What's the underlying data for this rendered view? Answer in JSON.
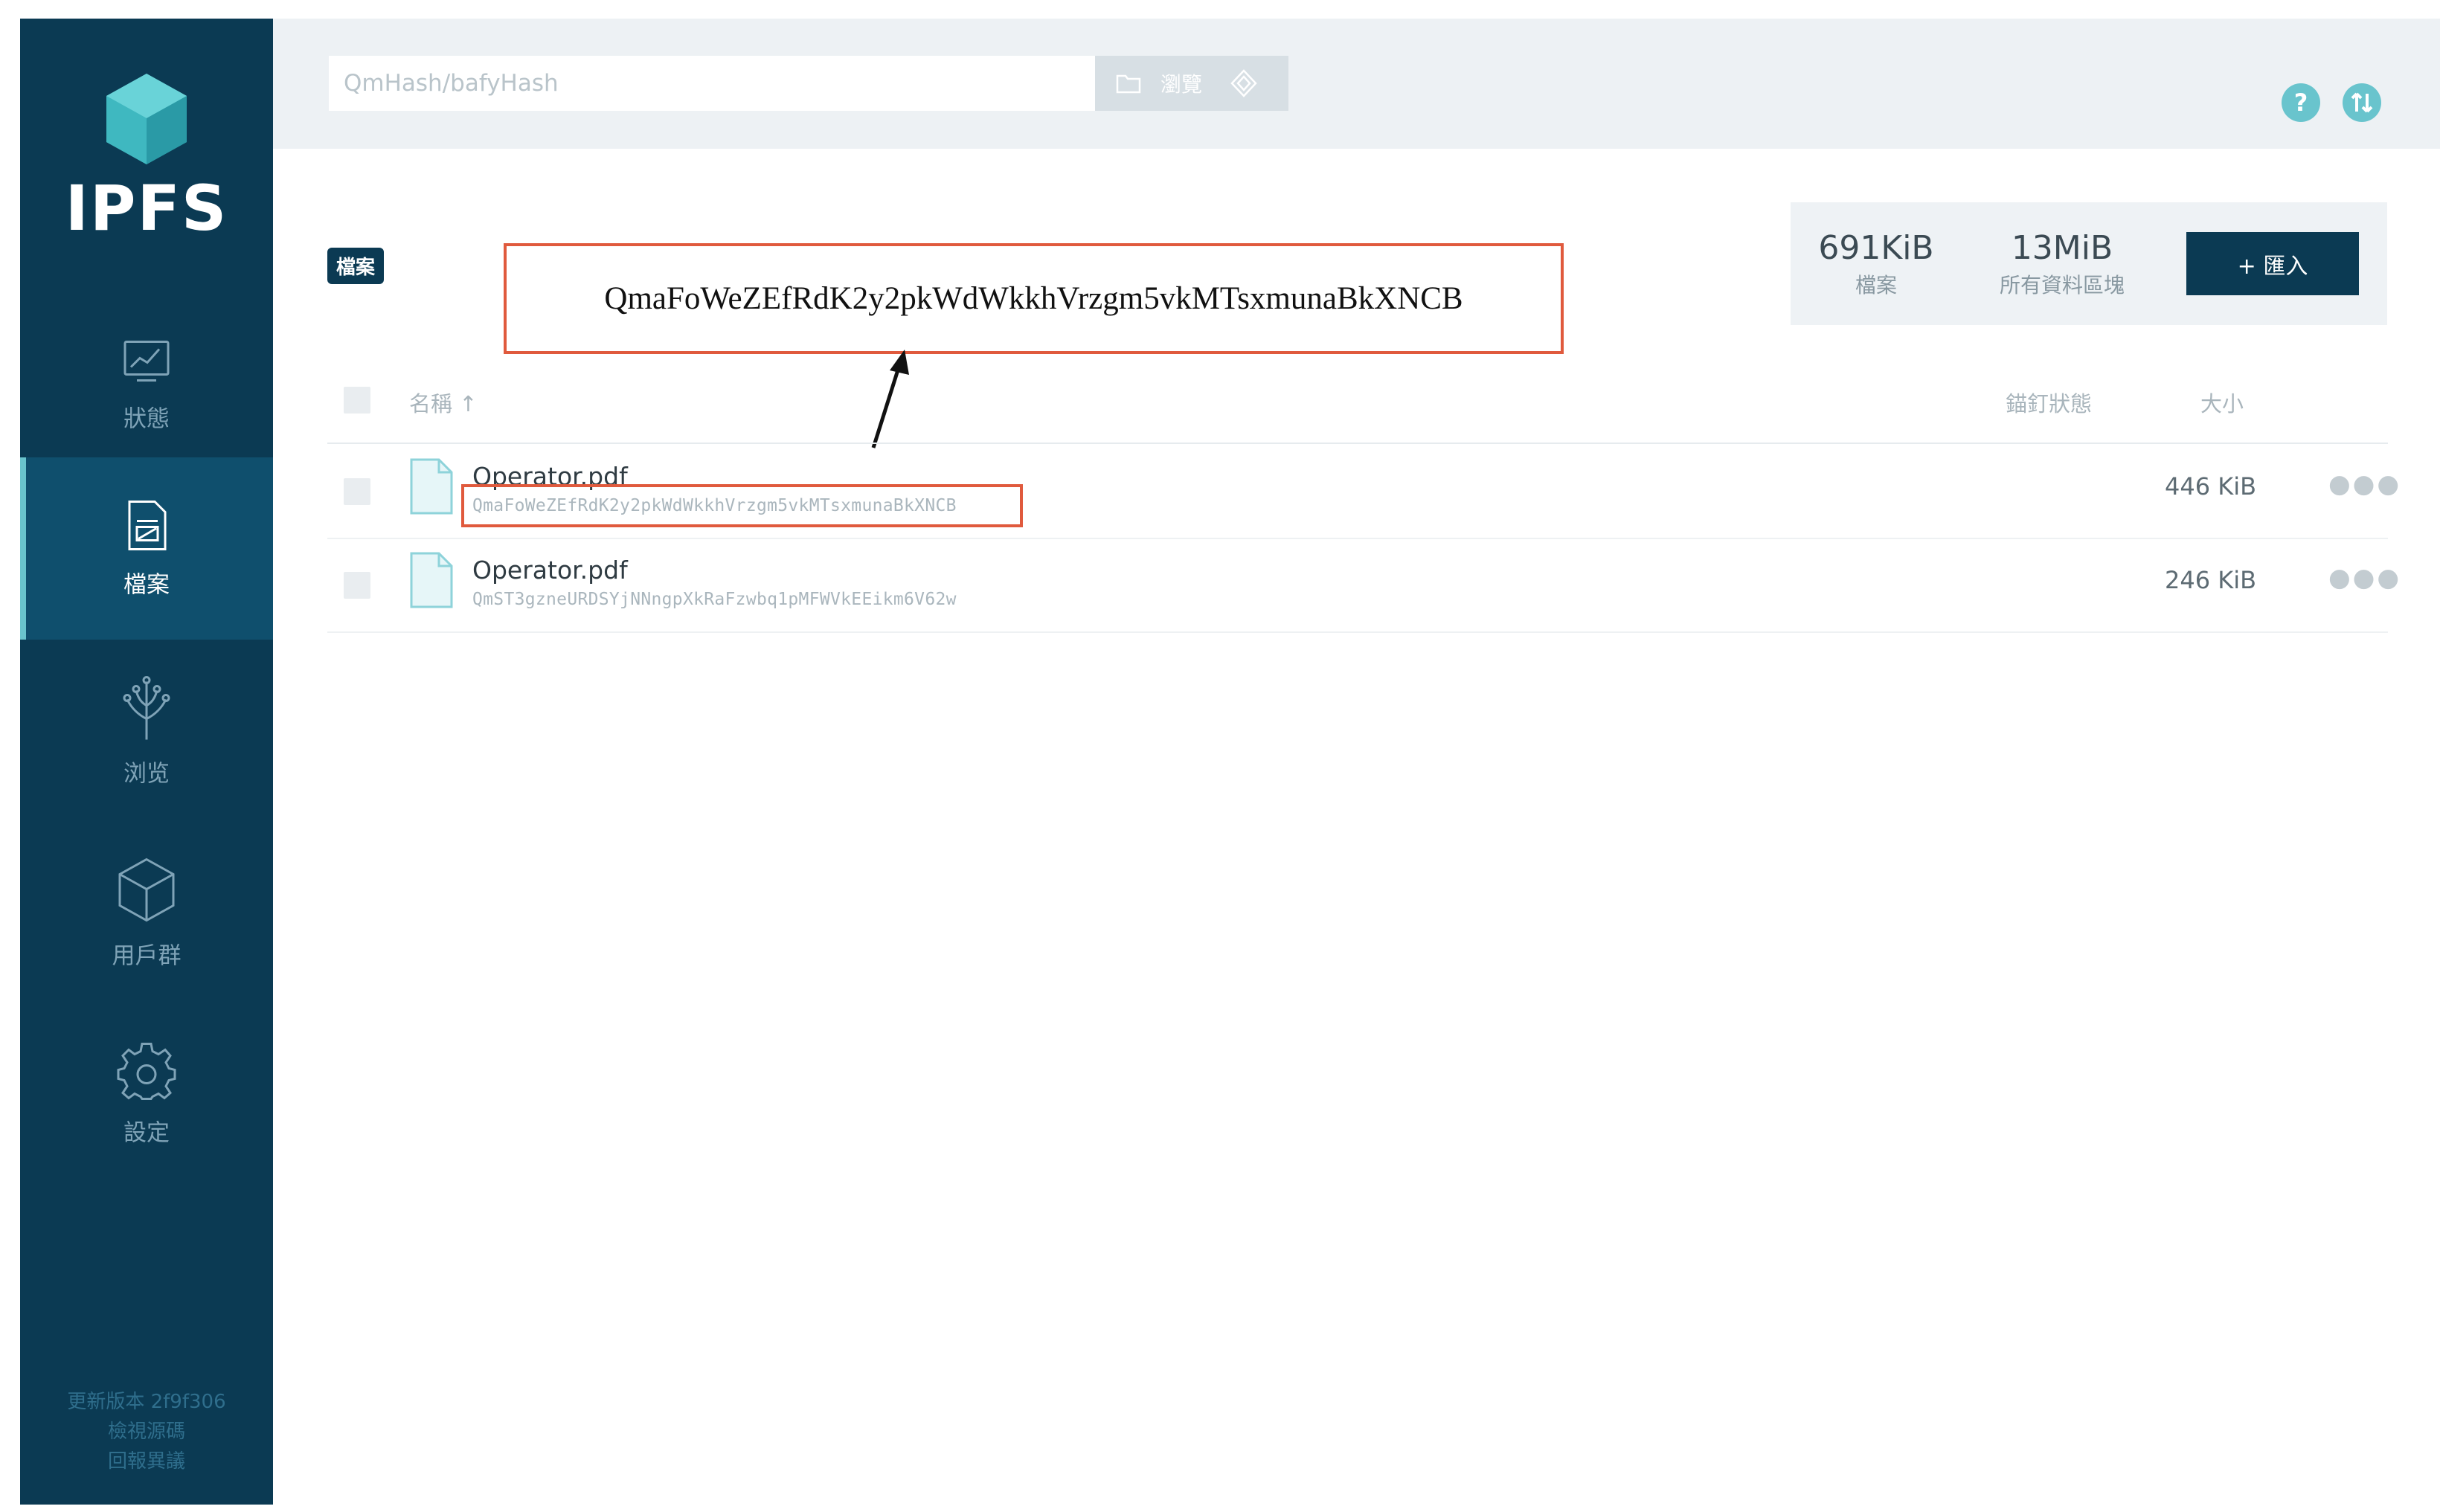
{
  "app": {
    "logo_text": "IPFS"
  },
  "sidebar": {
    "items": [
      {
        "label": "狀態",
        "icon": "status-chart-icon",
        "active": false
      },
      {
        "label": "檔案",
        "icon": "files-icon",
        "active": true
      },
      {
        "label": "浏览",
        "icon": "explore-tree-icon",
        "active": false
      },
      {
        "label": "用戶群",
        "icon": "peers-cube-icon",
        "active": false
      },
      {
        "label": "設定",
        "icon": "settings-gear-icon",
        "active": false
      }
    ],
    "footer": [
      "更新版本 2f9f306",
      "檢視源碼",
      "回報異議"
    ]
  },
  "topbar": {
    "search_placeholder": "QmHash/bafyHash",
    "browse_label": "瀏覽"
  },
  "breadcrumb": "檔案",
  "annotation": {
    "hash": "QmaFoWeZEfRdK2y2pkWdWkkhVrzgm5vkMTsxmunaBkXNCB"
  },
  "stats": {
    "files_value": "691KiB",
    "files_label": "檔案",
    "blocks_value": "13MiB",
    "blocks_label": "所有資料區塊"
  },
  "import_button": "+ 匯入",
  "table": {
    "headers": {
      "name": "名稱 ↑",
      "pin": "錨釘狀態",
      "size": "大小"
    },
    "rows": [
      {
        "name": "Operator.pdf",
        "hash": "QmaFoWeZEfRdK2y2pkWdWkkhVrzgm5vkMTsxmunaBkXNCB",
        "size": "446 KiB"
      },
      {
        "name": "Operator.pdf",
        "hash": "QmST3gzneURDSYjNNngpXkRaFzwbq1pMFWVkEEikm6V62w",
        "size": "246 KiB"
      }
    ]
  },
  "colors": {
    "sidebar_bg": "#0b3a53",
    "accent_teal": "#69c4cd",
    "annotation_red": "#e05a3d"
  }
}
